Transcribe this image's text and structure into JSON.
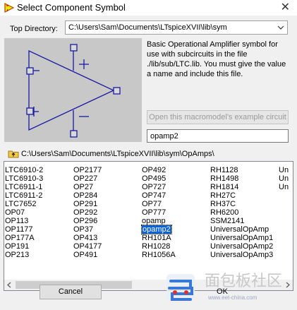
{
  "window": {
    "title": "Select Component Symbol",
    "close_glyph": "✕"
  },
  "top_directory": {
    "label": "Top Directory:",
    "value": "C:\\Users\\Sam\\Documents\\LTspiceXVII\\lib\\sym"
  },
  "description": "Basic Operational Amplifier symbol for use with subcircuits in the file ./lib/sub/LTC.lib.  You must give the value a name and include this file.",
  "macromodel_button": "Open this macromodel's example circuit",
  "name_field": {
    "value": "opamp2"
  },
  "current_path": "C:\\Users\\Sam\\Documents\\LTspiceXVII\\lib\\sym\\OpAmps\\",
  "list": {
    "columns": [
      [
        "LTC6910-2",
        "LTC6910-3",
        "LTC6911-1",
        "LTC6911-2",
        "LTC7652",
        "OP07",
        "OP113",
        "OP1177",
        "OP177A",
        "OP191",
        "OP213"
      ],
      [
        "OP2177",
        "OP227",
        "OP27",
        "OP284",
        "OP291",
        "OP292",
        "OP296",
        "OP37",
        "OP413",
        "OP4177",
        "OP491"
      ],
      [
        "OP492",
        "OP495",
        "OP727",
        "OP747",
        "OP77",
        "OP777",
        "opamp",
        "opamp2",
        "RH101A",
        "RH1028",
        "RH1056A"
      ],
      [
        "RH1128",
        "RH1498",
        "RH1814",
        "RH27C",
        "RH37C",
        "RH6200",
        "SSM2141",
        "UniversalOpAmp",
        "UniversalOpAmp1",
        "UniversalOpAmp2",
        "UniversalOpAmp3"
      ],
      [
        "Un",
        "Un",
        "Un"
      ]
    ],
    "selected": "opamp2"
  },
  "buttons": {
    "cancel": "Cancel",
    "ok": "OK"
  },
  "watermark": {
    "text": "面包板社区",
    "url": "www.eet-china.com"
  },
  "colors": {
    "schematic_blue": "#1a1aa0",
    "selection": "#0a64d8",
    "preview_bg": "#c8c8c8"
  },
  "icons": [
    "app-icon",
    "close-icon",
    "dropdown-arrow-icon",
    "folder-up-icon",
    "scroll-left-icon",
    "scroll-right-icon",
    "watermark-logo"
  ]
}
